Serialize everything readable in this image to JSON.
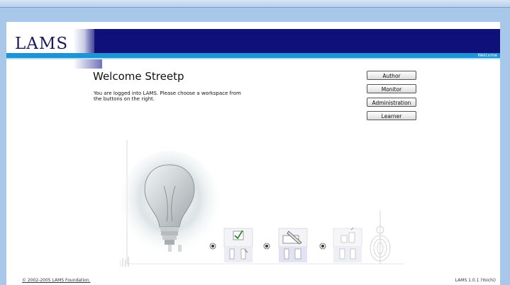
{
  "header": {
    "logo": "LAMS",
    "tab": "Welcome"
  },
  "main": {
    "title": "Welcome Streetp",
    "intro": "You are logged into LAMS. Please choose a workspace from the buttons on the right."
  },
  "buttons": {
    "author": "Author",
    "monitor": "Monitor",
    "administration": "Administration",
    "learner": "Learner"
  },
  "footer": {
    "copyright": "© 2002-2005 LAMS Foundation.",
    "version": "LAMS 1.0.1 (Yoichi)"
  },
  "colors": {
    "nav_bar": "#10107a",
    "accent_stripe": "#1c94d6",
    "background": "#a8c8ea"
  },
  "icons": [
    "lightbulb-icon",
    "checkmark-tool-icon",
    "pencil-tool-icon",
    "stamp-tool-icon",
    "radio-dot-icon"
  ]
}
